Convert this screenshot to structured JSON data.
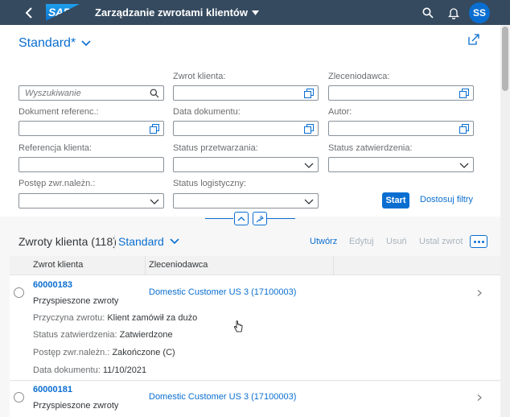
{
  "shell": {
    "logo_text": "SAP",
    "app_title": "Zarządzanie zwrotami klientów",
    "avatar_initials": "SS"
  },
  "filter": {
    "variant": "Standard*",
    "search_placeholder": "Wyszukiwanie",
    "labels": {
      "zwrot_klienta": "Zwrot klienta:",
      "zleceniodawca": "Zleceniodawca:",
      "dokument_referenc": "Dokument referenc.:",
      "data_dokumentu": "Data dokumentu:",
      "autor": "Autor:",
      "referencja_klienta": "Referencja klienta:",
      "status_przetwarzania": "Status przetwarzania:",
      "status_zatwierdzenia": "Status zatwierdzenia:",
      "postep": "Postęp zwr.należn.:",
      "status_logistyczny": "Status logistyczny:"
    },
    "start_label": "Start",
    "adapt_label": "Dostosuj filtry"
  },
  "table": {
    "title": "Zwroty klienta (118)",
    "variant": "Standard",
    "actions": {
      "create": "Utwórz",
      "edit": "Edytuj",
      "delete": "Usuń",
      "set_return": "Ustal zwrot"
    },
    "columns": [
      "Zwrot klienta",
      "Zleceniodawca"
    ],
    "rows": [
      {
        "id": "60000183",
        "type": "Przyspieszone zwroty",
        "customer": "Domestic Customer US 3 (17100003)",
        "attrs": [
          {
            "k": "Przyczyna zwrotu:",
            "v": "Klient zamówił za dużo"
          },
          {
            "k": "Status zatwierdzenia:",
            "v": "Zatwierdzone"
          },
          {
            "k": "Postęp zwr.należn.:",
            "v": "Zakończone (C)"
          },
          {
            "k": "Data dokumentu:",
            "v": "11/10/2021"
          }
        ]
      },
      {
        "id": "60000181",
        "type": "Przyspieszone zwroty",
        "customer": "Domestic Customer US 3 (17100003)"
      }
    ]
  },
  "colors": {
    "shell": "#354a5f",
    "brand": "#0a6ed1",
    "text": "#32363a",
    "label": "#6a6d70"
  }
}
